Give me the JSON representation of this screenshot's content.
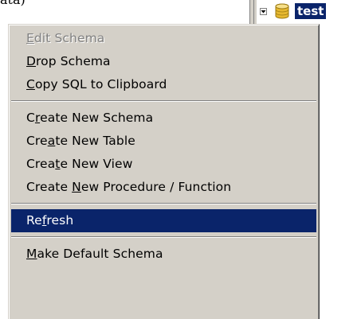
{
  "fragment_text": "ata)",
  "tree": {
    "node_label": "test"
  },
  "menu": {
    "items": [
      {
        "pre": "",
        "key": "E",
        "post": "dit Schema",
        "disabled": true,
        "highlighted": false
      },
      {
        "pre": "",
        "key": "D",
        "post": "rop Schema",
        "disabled": false,
        "highlighted": false
      },
      {
        "pre": "",
        "key": "C",
        "post": "opy SQL to Clipboard",
        "disabled": false,
        "highlighted": false
      },
      {
        "pre": "C",
        "key": "r",
        "post": "eate New Schema",
        "disabled": false,
        "highlighted": false
      },
      {
        "pre": "Cre",
        "key": "a",
        "post": "te New Table",
        "disabled": false,
        "highlighted": false
      },
      {
        "pre": "Crea",
        "key": "t",
        "post": "e New View",
        "disabled": false,
        "highlighted": false
      },
      {
        "pre": "Create ",
        "key": "N",
        "post": "ew Procedure / Function",
        "disabled": false,
        "highlighted": false
      },
      {
        "pre": "Re",
        "key": "f",
        "post": "resh",
        "disabled": false,
        "highlighted": true
      },
      {
        "pre": "",
        "key": "M",
        "post": "ake Default Schema",
        "disabled": false,
        "highlighted": false
      }
    ]
  },
  "colors": {
    "menu_bg": "#d4d0c8",
    "highlight": "#0a246a",
    "disabled_text": "#808080"
  }
}
